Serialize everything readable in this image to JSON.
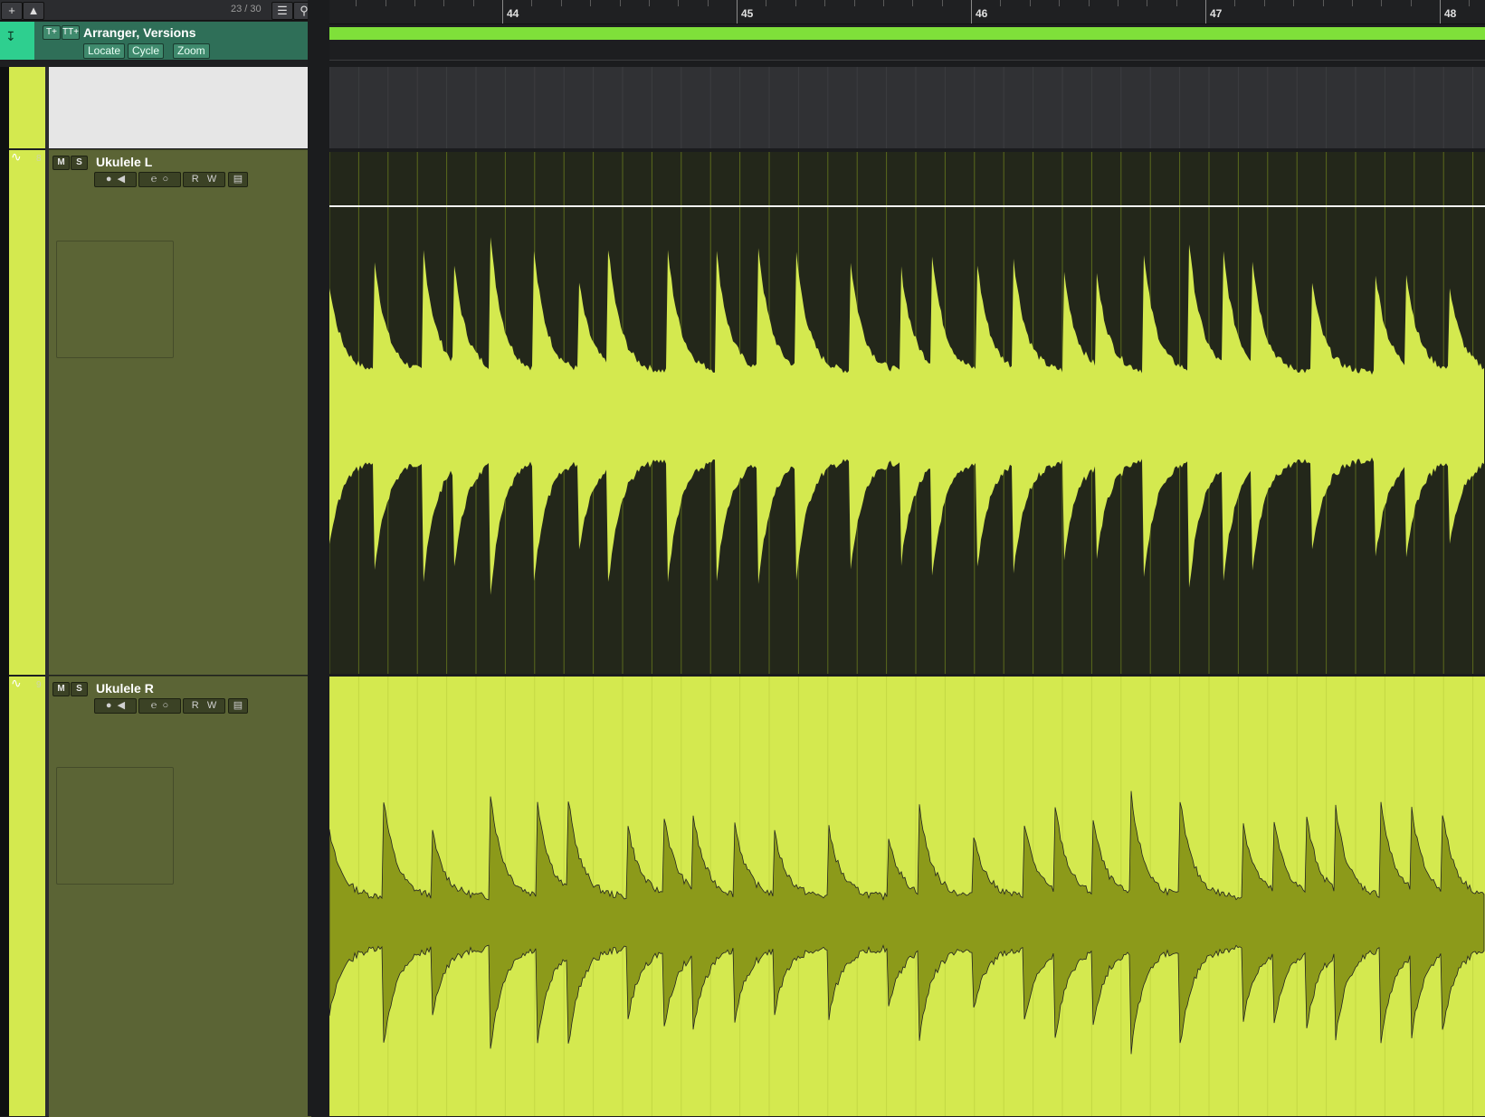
{
  "toolbar": {
    "add_icon": "plus-icon",
    "track_count": "23 / 30",
    "view_icon": "list-view-icon",
    "search_icon": "search-icon"
  },
  "arranger": {
    "title": "Arranger, Versions",
    "buttons": [
      "Locate",
      "Cycle",
      "Zoom"
    ],
    "tool1": "T+",
    "tool2": "TT+"
  },
  "ruler": {
    "bars": [
      "44",
      "45",
      "46",
      "47",
      "48"
    ]
  },
  "tracks": [
    {
      "number": "8",
      "name": "Ukulele L",
      "mute": "M",
      "solo": "S",
      "read": "R",
      "write": "W",
      "color": "#d4e94f"
    },
    {
      "number": "9",
      "name": "Ukulele R",
      "mute": "M",
      "solo": "S",
      "read": "R",
      "write": "W",
      "color": "#d4e94f"
    }
  ],
  "colors": {
    "track_color": "#d4e94f",
    "arranger_event": "#7fe03a",
    "arranger_header": "#2f6f58"
  }
}
